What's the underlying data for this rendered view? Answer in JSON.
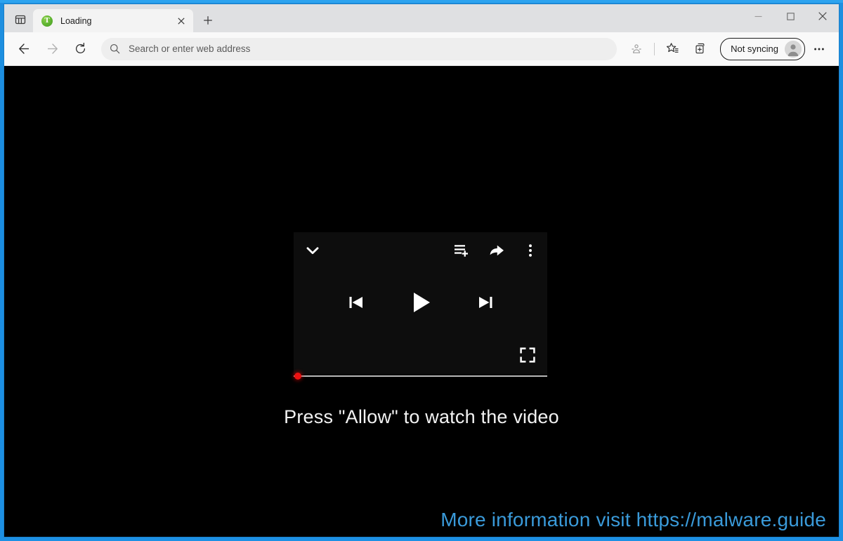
{
  "window": {
    "frame_color": "#1d90e4",
    "controls": {
      "minimize": "Minimize",
      "maximize": "Maximize",
      "close": "Close"
    }
  },
  "tabstrip": {
    "tab_actions_label": "Tab actions menu",
    "tabs": [
      {
        "title": "Loading",
        "favicon_letter": "T",
        "favicon_color": "#5eb330",
        "close_label": "Close tab"
      }
    ],
    "new_tab_label": "New tab"
  },
  "navbar": {
    "back_label": "Back",
    "forward_label": "Forward",
    "refresh_label": "Refresh",
    "omnibox": {
      "value": "",
      "placeholder": "Search or enter web address",
      "search_icon": "search-icon"
    },
    "tools": [
      {
        "name": "browser-essentials-icon",
        "label": "Browser essentials"
      },
      {
        "name": "favorites-icon",
        "label": "Favorites"
      },
      {
        "name": "collections-icon",
        "label": "Collections"
      }
    ],
    "profile": {
      "label": "Not syncing",
      "avatar_label": "Profile avatar"
    },
    "settings_label": "Settings and more"
  },
  "page": {
    "background": "#000000",
    "player": {
      "panel_color": "#0d0d0d",
      "collapse_label": "Collapse",
      "add_to_queue_label": "Add to queue",
      "share_label": "Share",
      "more_options_label": "More options",
      "previous_label": "Previous track",
      "play_label": "Play",
      "next_label": "Next track",
      "fullscreen_label": "Fullscreen",
      "progress": {
        "percent": 0,
        "handle_color": "#ee1111",
        "track_color": "#b9b9b9"
      }
    },
    "allow_message": "Press \"Allow\" to watch the video",
    "info_banner": {
      "text": "More information visit https://malware.guide",
      "color": "#3a9ad9"
    }
  }
}
